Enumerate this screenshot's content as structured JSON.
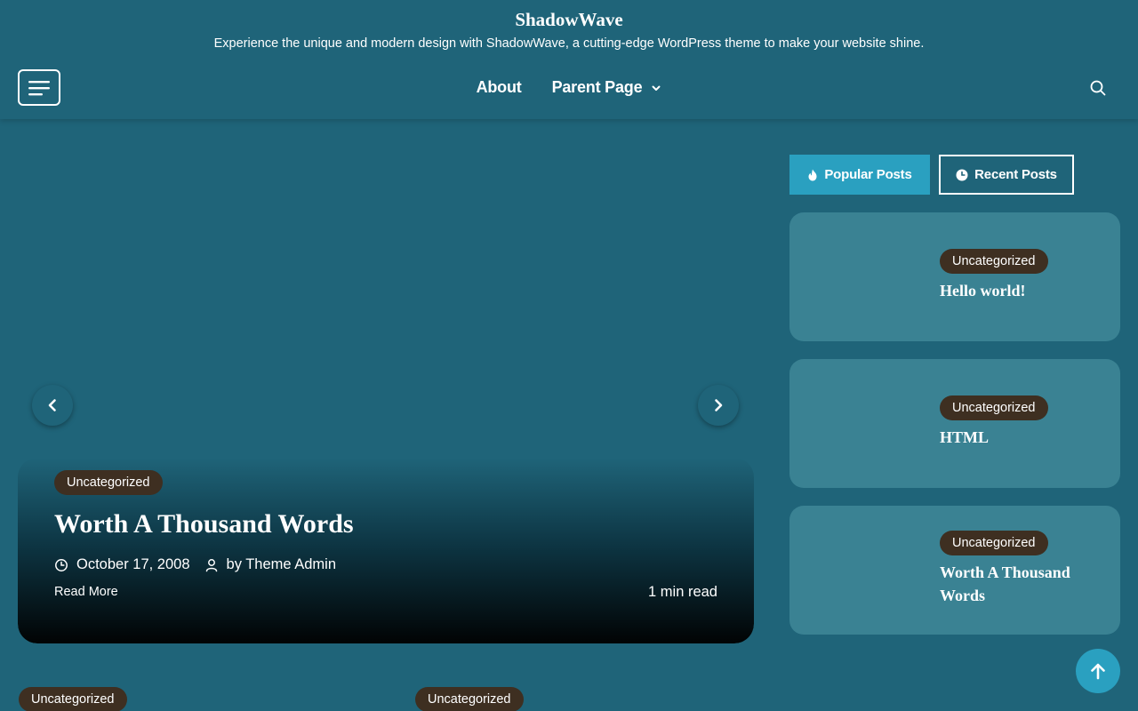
{
  "site": {
    "title": "ShadowWave",
    "tagline": "Experience the unique and modern design with ShadowWave, a cutting-edge WordPress theme to make your website shine."
  },
  "nav": {
    "items": [
      {
        "label": "About"
      },
      {
        "label": "Parent Page"
      }
    ]
  },
  "hero": {
    "category": "Uncategorized",
    "title": "Worth A Thousand Words",
    "date": "October 17, 2008",
    "author": "by Theme Admin",
    "read_more": "Read More",
    "read_time": "1 min read"
  },
  "sidebar": {
    "tabs": [
      {
        "label": "Popular Posts"
      },
      {
        "label": "Recent Posts"
      }
    ],
    "posts": [
      {
        "category": "Uncategorized",
        "title": "Hello world!"
      },
      {
        "category": "Uncategorized",
        "title": "HTML"
      },
      {
        "category": "Uncategorized",
        "title": "Worth A Thousand Words"
      }
    ]
  },
  "bottom": {
    "badges": [
      "Uncategorized",
      "Uncategorized"
    ]
  },
  "colors": {
    "background": "#1f6479",
    "card": "#3a8293",
    "accent": "#2aa0c0",
    "badge": "#3e2f21"
  }
}
